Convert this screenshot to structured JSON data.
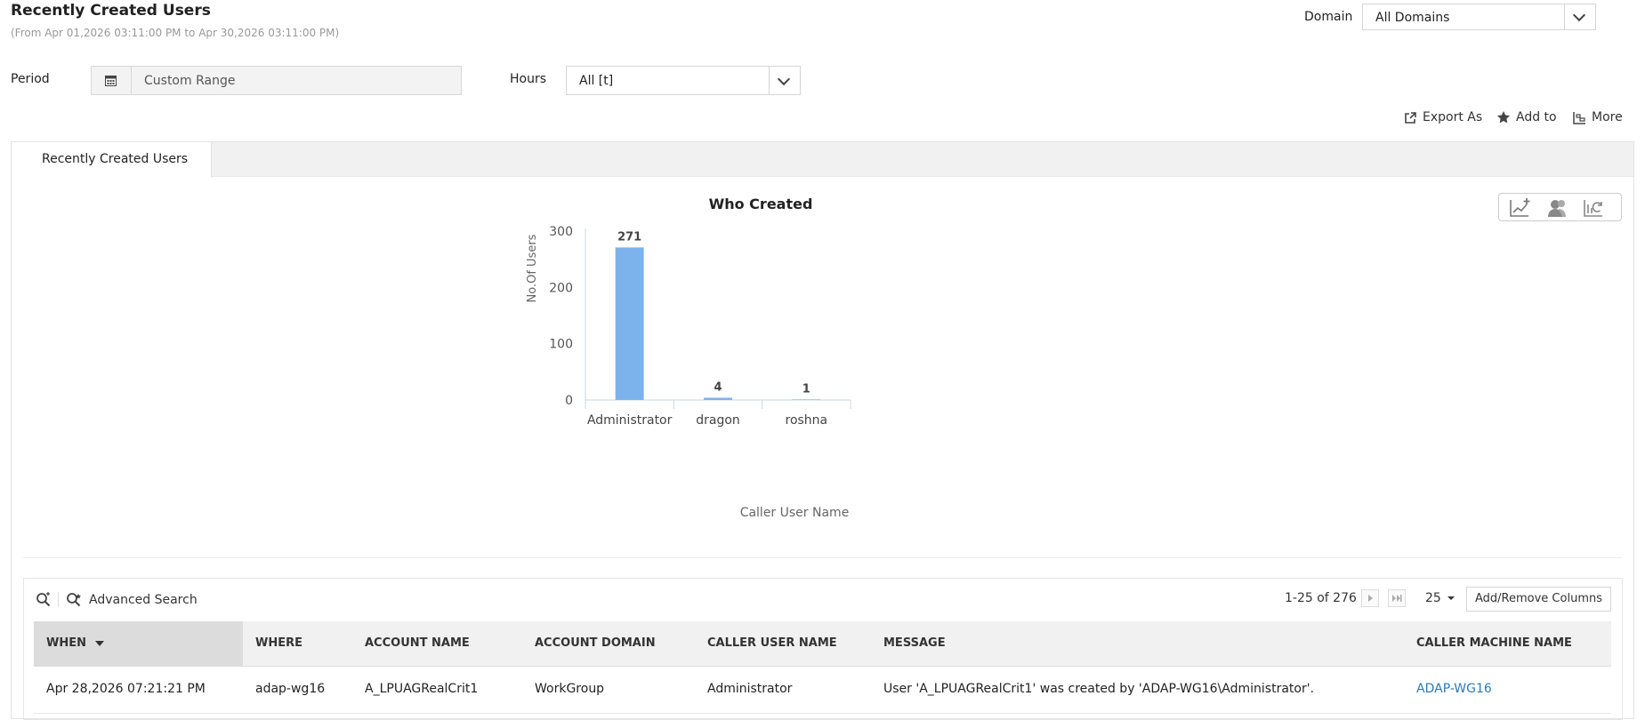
{
  "header": {
    "title": "Recently Created Users",
    "date_range": "(From Apr 01,2026 03:11:00 PM to Apr 30,2026 03:11:00 PM)"
  },
  "filters": {
    "domain_label": "Domain",
    "domain_value": "All Domains",
    "period_label": "Period",
    "period_value": "Custom Range",
    "hours_label": "Hours",
    "hours_value": "All [t]"
  },
  "toolbar": {
    "export_label": "Export As",
    "add_to_label": "Add to",
    "more_label": "More"
  },
  "tabs": [
    {
      "label": "Recently Created Users",
      "active": true
    }
  ],
  "chart_data": {
    "type": "bar",
    "title": "Who Created",
    "xlabel": "Caller User Name",
    "ylabel": "No.Of Users",
    "categories": [
      "Administrator",
      "dragon",
      "roshna"
    ],
    "values": [
      271,
      4,
      1
    ],
    "data_labels": [
      "271",
      "4",
      "1"
    ],
    "ylim": [
      0,
      300
    ],
    "yticks": [
      0,
      100,
      200,
      300
    ],
    "grid": false,
    "legend": "none",
    "bar_color": "#7db3ec"
  },
  "grid": {
    "search_icon": "search-icon",
    "advanced_search_label": "Advanced Search",
    "pagination": "1-25 of 276",
    "page_size": "25",
    "add_remove_columns_label": "Add/Remove Columns",
    "sort_indicator": "sort-descending-icon",
    "columns": [
      "WHEN",
      "WHERE",
      "ACCOUNT NAME",
      "ACCOUNT DOMAIN",
      "CALLER USER NAME",
      "MESSAGE",
      "CALLER MACHINE NAME"
    ],
    "rows": [
      {
        "when": "Apr 28,2026 07:21:21 PM",
        "where": "adap-wg16",
        "account_name": "A_LPUAGRealCrit1",
        "account_domain": "WorkGroup",
        "caller_user_name": "Administrator",
        "message": "User 'A_LPUAGRealCrit1' was created by 'ADAP-WG16\\Administrator'.",
        "caller_machine_name": "ADAP-WG16"
      }
    ]
  },
  "colors": {
    "link": "#2a7ab9",
    "bar": "#7db3ec",
    "header_bg": "#f1f1f1"
  }
}
